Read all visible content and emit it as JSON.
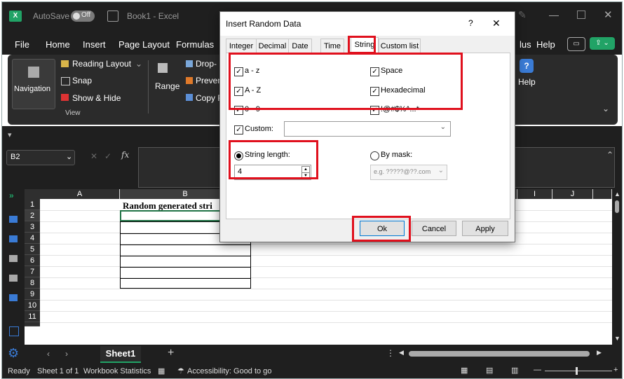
{
  "titlebar": {
    "app_icon": "X",
    "autosave": "AutoSave",
    "toggle": "Off",
    "title": "Book1 - Excel"
  },
  "ribbon_tabs": [
    "File",
    "Home",
    "Insert",
    "Page Layout",
    "Formulas",
    "lus",
    "Help"
  ],
  "ribbon": {
    "navigation": "Navigation",
    "reading_layout": "Reading Layout",
    "snap": "Snap",
    "show_hide": "Show & Hide",
    "group_view": "View",
    "range": "Range",
    "drop": "Drop-",
    "preven": "Preven",
    "copy": "Copy R",
    "help": "Help"
  },
  "formula_bar": {
    "name_box": "B2",
    "fx": "fx"
  },
  "grid": {
    "col_a": "A",
    "col_b": "B",
    "col_i": "I",
    "col_j": "J",
    "rows": [
      "1",
      "2",
      "3",
      "4",
      "5",
      "6",
      "7",
      "8",
      "9",
      "10",
      "11"
    ],
    "b1": "Random generated stri"
  },
  "sheet": {
    "tab": "Sheet1",
    "add": "+"
  },
  "status": {
    "ready": "Ready",
    "sheet": "Sheet 1 of 1",
    "wb_stats": "Workbook Statistics",
    "accessibility": "Accessibility: Good to go"
  },
  "dialog": {
    "title": "Insert Random Data",
    "help": "?",
    "close": "✕",
    "tabs": [
      "Integer",
      "Decimal",
      "Date",
      "Time",
      "String",
      "Custom list"
    ],
    "selected_tab": "String",
    "options": {
      "az": "a - z",
      "AZ": "A - Z",
      "09": "0 - 9",
      "space": "Space",
      "hex": "Hexadecimal",
      "special": "!@#$%^...*"
    },
    "custom_label": "Custom:",
    "custom_value": "",
    "string_length_label": "String length:",
    "string_length_value": "4",
    "by_mask_label": "By mask:",
    "mask_placeholder": "e.g. ?????@??.com",
    "buttons": {
      "ok": "Ok",
      "cancel": "Cancel",
      "apply": "Apply"
    }
  },
  "colors": {
    "accent_red": "#e0101d",
    "excel_green": "#21a366",
    "dark_bg": "#1f1f1f"
  }
}
